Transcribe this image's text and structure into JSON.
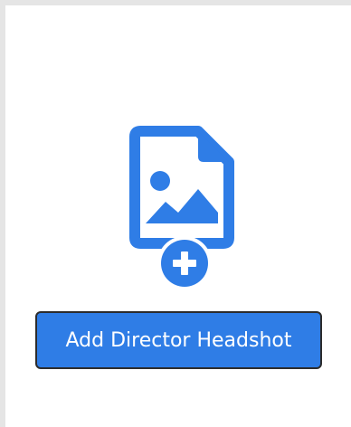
{
  "upload": {
    "icon": "image-file-add-icon",
    "button_label": "Add Director Headshot"
  },
  "colors": {
    "accent": "#2f7de6",
    "button_border": "#2c2c2c",
    "background": "#e5e5e5",
    "panel": "#ffffff"
  }
}
